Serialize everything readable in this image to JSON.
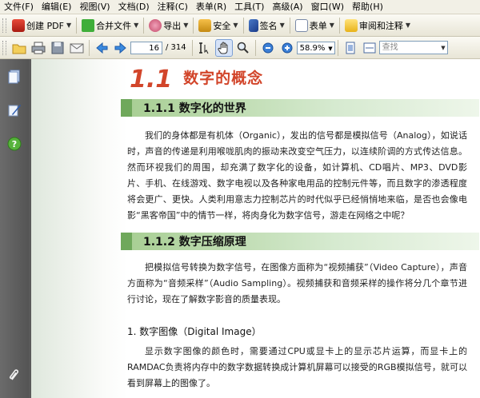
{
  "menu": [
    "文件(F)",
    "编辑(E)",
    "视图(V)",
    "文档(D)",
    "注释(C)",
    "表单(R)",
    "工具(T)",
    "高级(A)",
    "窗口(W)",
    "帮助(H)"
  ],
  "toolbar1": {
    "create_pdf": "创建 PDF",
    "merge_files": "合并文件",
    "export": "导出",
    "security": "安全",
    "sign": "签名",
    "forms": "表单",
    "review_comment": "审阅和注释"
  },
  "toolbar2": {
    "page_number": "16",
    "page_total": "/ 314",
    "zoom": "58.9%",
    "search_placeholder": "查找"
  },
  "document": {
    "chapter_number": "1.1",
    "chapter_title": "数字的概念",
    "section1_title": "1.1.1  数字化的世界",
    "section1_paragraph": "我们的身体都是有机体（Organic），发出的信号都是模拟信号（Analog），如说话时，声音的传递是利用喉咙肌肉的振动来改变空气压力，以连续阶调的方式传达信息。然而环视我们的周围，却充满了数字化的设备，如计算机、CD唱片、MP3、DVD影片、手机、在线游戏、数字电视以及各种家电用品的控制元件等，而且数字的渗透程度将会更广、更快。人类利用意志力控制芯片的时代似乎已经悄悄地来临，是否也会像电影“黑客帝国”中的情节一样，将肉身化为数字信号，游走在网络之中呢？",
    "section2_title": "1.1.2  数字压缩原理",
    "section2_paragraph": "把模拟信号转换为数字信号，在图像方面称为“视频捕获”（Video Capture），声音方面称为“音频采样”（Audio Sampling）。视频捕获和音频采样的操作将分几个章节进行讨论，现在了解数字影音的质量表现。",
    "subsection_title": "1. 数字图像（Digital Image）",
    "subsection_paragraph": "显示数字图像的颜色时，需要通过CPU或显卡上的显示芯片运算，而显卡上的RAMDAC负责将内存中的数字数据转换成计算机屏幕可以接受的RGB模拟信号，就可以看到屏幕上的图像了。"
  }
}
